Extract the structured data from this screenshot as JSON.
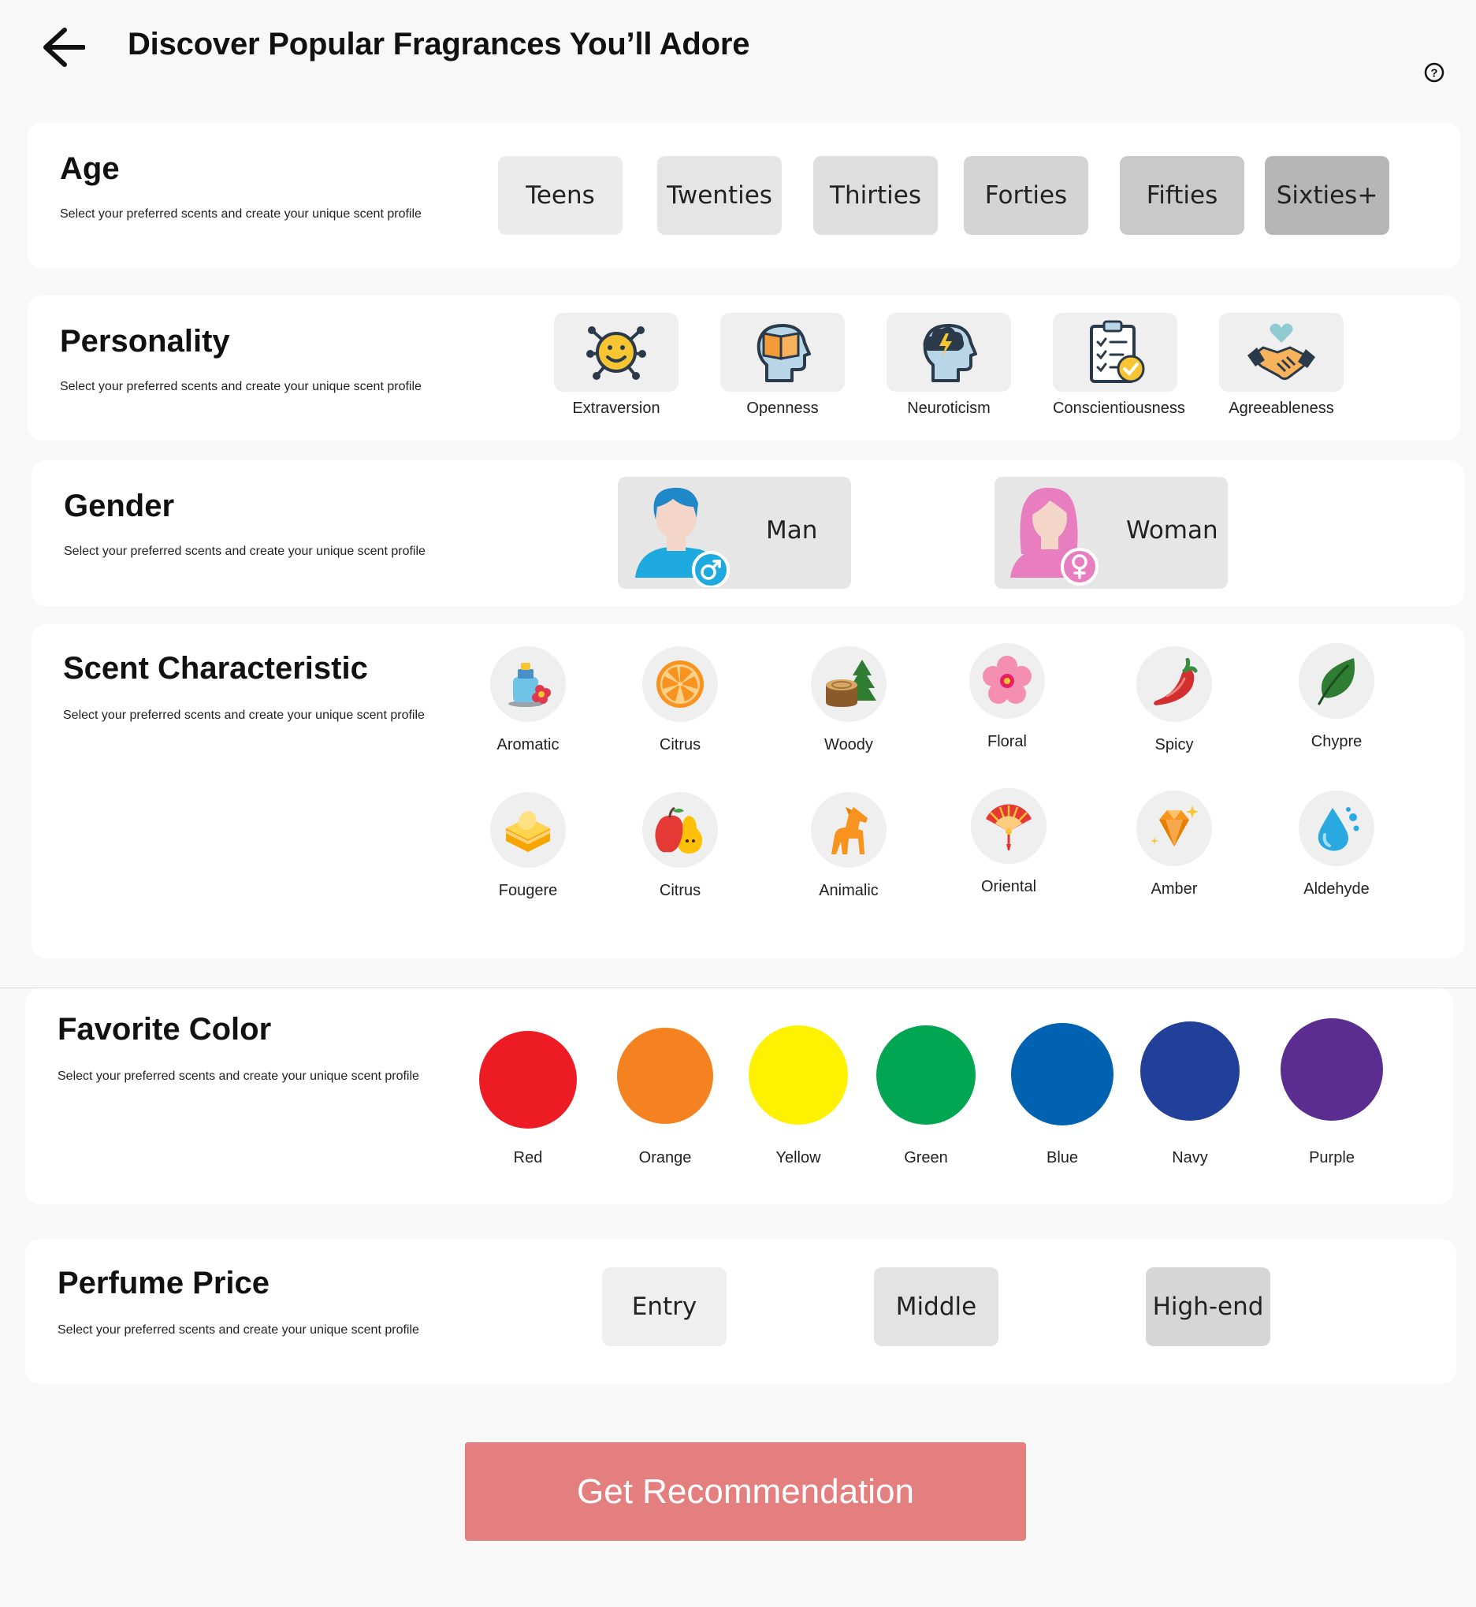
{
  "header": {
    "title": "Discover Popular Fragrances You’ll Adore",
    "back_icon": "arrow-left-icon",
    "help_icon": "question-circle-icon"
  },
  "sections": {
    "age": {
      "title": "Age",
      "subtitle": "Select your preferred scents and create your unique scent profile",
      "options": [
        "Teens",
        "Twenties",
        "Thirties",
        "Forties",
        "Fifties",
        "Sixties+"
      ],
      "option_colors": [
        "#ebebeb",
        "#e5e5e5",
        "#dedede",
        "#d4d4d4",
        "#c9c9c9",
        "#b6b6b6"
      ]
    },
    "personality": {
      "title": "Personality",
      "subtitle": "Select your preferred scents and create your unique scent profile",
      "options": [
        {
          "label": "Extraversion",
          "icon": "smiley-network-icon"
        },
        {
          "label": "Openness",
          "icon": "head-book-icon"
        },
        {
          "label": "Neuroticism",
          "icon": "head-storm-icon"
        },
        {
          "label": "Conscientiousness",
          "icon": "clipboard-check-icon"
        },
        {
          "label": "Agreeableness",
          "icon": "handshake-heart-icon"
        }
      ]
    },
    "gender": {
      "title": "Gender",
      "subtitle": "Select your preferred scents and create your unique scent profile",
      "options": [
        {
          "label": "Man",
          "icon": "male-avatar-icon"
        },
        {
          "label": "Woman",
          "icon": "female-avatar-icon"
        }
      ]
    },
    "scent": {
      "title": "Scent Characteristic",
      "subtitle": "Select your preferred scents and create your unique scent profile",
      "options": [
        {
          "label": "Aromatic",
          "icon": "perfume-bottle-icon"
        },
        {
          "label": "Citrus",
          "icon": "orange-slice-icon"
        },
        {
          "label": "Woody",
          "icon": "tree-stump-icon"
        },
        {
          "label": "Floral",
          "icon": "cherry-blossom-icon"
        },
        {
          "label": "Spicy",
          "icon": "chili-pepper-icon"
        },
        {
          "label": "Chypre",
          "icon": "leaf-icon"
        },
        {
          "label": "Fougere",
          "icon": "cake-icon"
        },
        {
          "label": "Citrus",
          "icon": "apple-pear-icon"
        },
        {
          "label": "Animalic",
          "icon": "horse-icon"
        },
        {
          "label": "Oriental",
          "icon": "fan-icon"
        },
        {
          "label": "Amber",
          "icon": "amber-gem-icon"
        },
        {
          "label": "Aldehyde",
          "icon": "water-drop-icon"
        }
      ]
    },
    "color": {
      "title": "Favorite Color",
      "subtitle": "Select your preferred scents and create your unique scent profile",
      "options": [
        {
          "label": "Red",
          "color": "#ed1c24"
        },
        {
          "label": "Orange",
          "color": "#f58220"
        },
        {
          "label": "Yellow",
          "color": "#fff200"
        },
        {
          "label": "Green",
          "color": "#00a651"
        },
        {
          "label": "Blue",
          "color": "#0062b1"
        },
        {
          "label": "Navy",
          "color": "#21409a"
        },
        {
          "label": "Purple",
          "color": "#5c2d91"
        }
      ]
    },
    "price": {
      "title": "Perfume Price",
      "subtitle": "Select your preferred scents and create your unique scent profile",
      "options": [
        "Entry",
        "Middle",
        "High-end"
      ],
      "option_colors": [
        "#efefef",
        "#e3e3e3",
        "#d6d6d6"
      ]
    }
  },
  "cta": {
    "label": "Get Recommendation",
    "color": "#e37f7f"
  }
}
